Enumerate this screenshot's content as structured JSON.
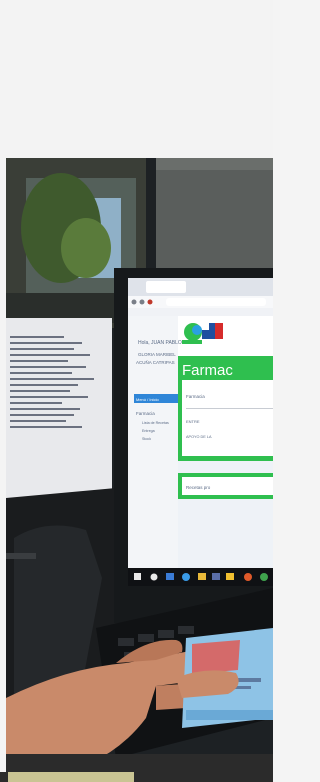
{
  "photo": {
    "subject": "pharmacy staff holding an ID card in front of a computer monitor",
    "colors": {
      "monitor_bezel": "#16191b",
      "screen_bg": "#eef2f7",
      "header_green": "#2fbf4f",
      "pharmacy_title": "#1c8de0",
      "skin": "#c98a6a",
      "card": "#8ec3e6"
    }
  },
  "screen": {
    "greeting": "Hola, JUAN PABLO",
    "user_line1": "GLORIA MARIBEL",
    "user_line2": "ACUÑA CATRIPAS",
    "side_active": "Menú / Inicio",
    "side_section": "Farmacia",
    "side_items": [
      "Lista de Recetas",
      "Entrega",
      "Stock"
    ],
    "page_title": "Farmac",
    "field1": "Farmacia",
    "field2": "ENTRE",
    "field3": "APOYO DE LA",
    "bottom_label": "Recetas pro"
  }
}
